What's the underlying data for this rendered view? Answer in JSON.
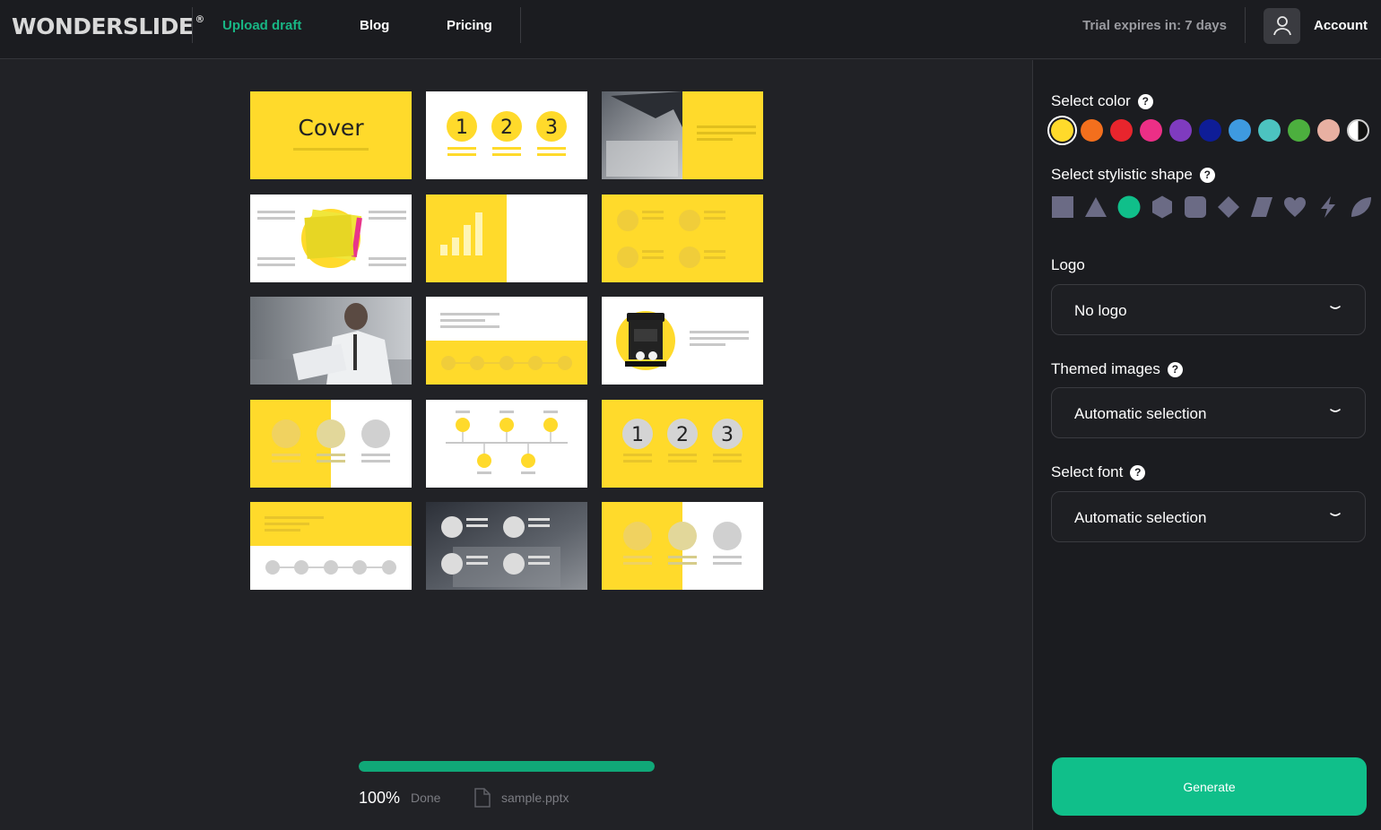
{
  "brand": {
    "name": "WONDERSLIDE",
    "mark": "®"
  },
  "nav": {
    "upload_draft": "Upload draft",
    "blog": "Blog",
    "pricing": "Pricing"
  },
  "header": {
    "trial": "Trial expires in: 7 days",
    "account": "Account"
  },
  "slides": {
    "cover_label": "Cover",
    "numbers": [
      "1",
      "2",
      "3"
    ]
  },
  "colors": {
    "accent": "#ffda2b",
    "green": "#10bf8a"
  },
  "upload": {
    "percent": "100%",
    "progress": 1.0,
    "status": "Done",
    "file_name": "sample.pptx"
  },
  "panel": {
    "color_label": "Select color",
    "color_swatches": [
      "#ffda2b",
      "#f36f1d",
      "#e8252d",
      "#ec2f86",
      "#7f3bbf",
      "#0e1d97",
      "#3e9ae0",
      "#4cc3c0",
      "#4caf3e",
      "#e8b0a2",
      "split-black-white"
    ],
    "selected_color": "#ffda2b",
    "shape_label": "Select stylistic shape",
    "shapes": [
      "square",
      "triangle",
      "circle",
      "hexagon",
      "rounded-square",
      "diamond",
      "parallelogram",
      "heart",
      "lightning",
      "leaf"
    ],
    "selected_shape": "circle",
    "logo_label": "Logo",
    "logo_value": "No logo",
    "images_label": "Themed images",
    "images_value": "Automatic selection",
    "font_label": "Select font",
    "font_value": "Automatic selection",
    "generate": "Generate"
  }
}
